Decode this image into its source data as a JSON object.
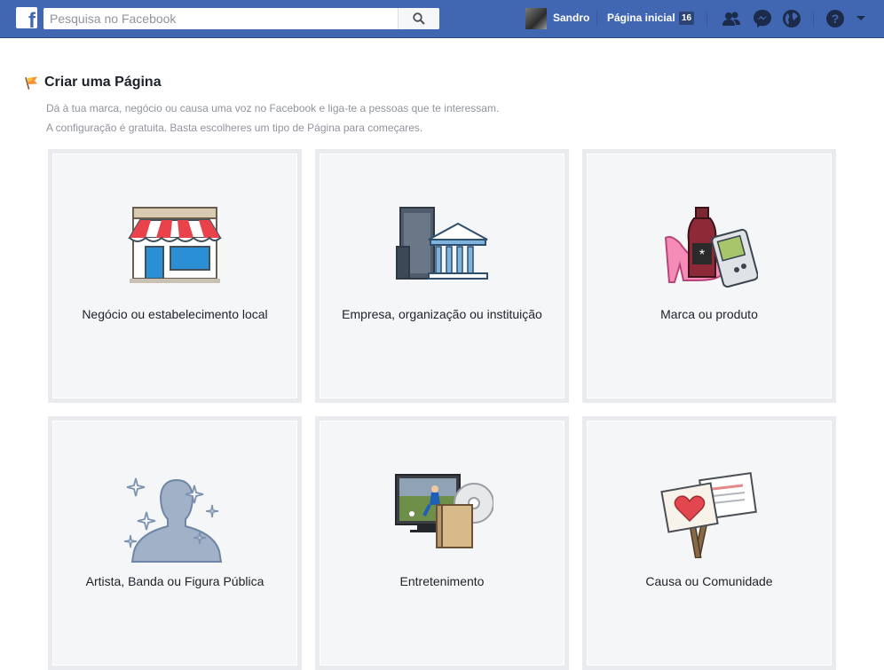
{
  "header": {
    "search_placeholder": "Pesquisa no Facebook",
    "user_name": "Sandro",
    "home_label": "Página inicial",
    "home_count": "16"
  },
  "page": {
    "title": "Criar uma Página",
    "description_line1": "Dá à tua marca, negócio ou causa uma voz no Facebook e liga-te a pessoas que te interessam.",
    "description_line2": "A configuração é gratuita. Basta escolheres um tipo de Página para começares."
  },
  "categories": [
    {
      "label": "Negócio ou estabelecimento local",
      "icon": "storefront-icon"
    },
    {
      "label": "Empresa, organização ou instituição",
      "icon": "buildings-icon"
    },
    {
      "label": "Marca ou produto",
      "icon": "products-icon"
    },
    {
      "label": "Artista, Banda ou Figura Pública",
      "icon": "public-figure-icon"
    },
    {
      "label": "Entretenimento",
      "icon": "entertainment-icon"
    },
    {
      "label": "Causa ou Comunidade",
      "icon": "cause-signs-icon"
    }
  ],
  "colors": {
    "topbar": "#4267b2",
    "card_background": "#f5f6f7",
    "card_border": "#e9ebee"
  }
}
